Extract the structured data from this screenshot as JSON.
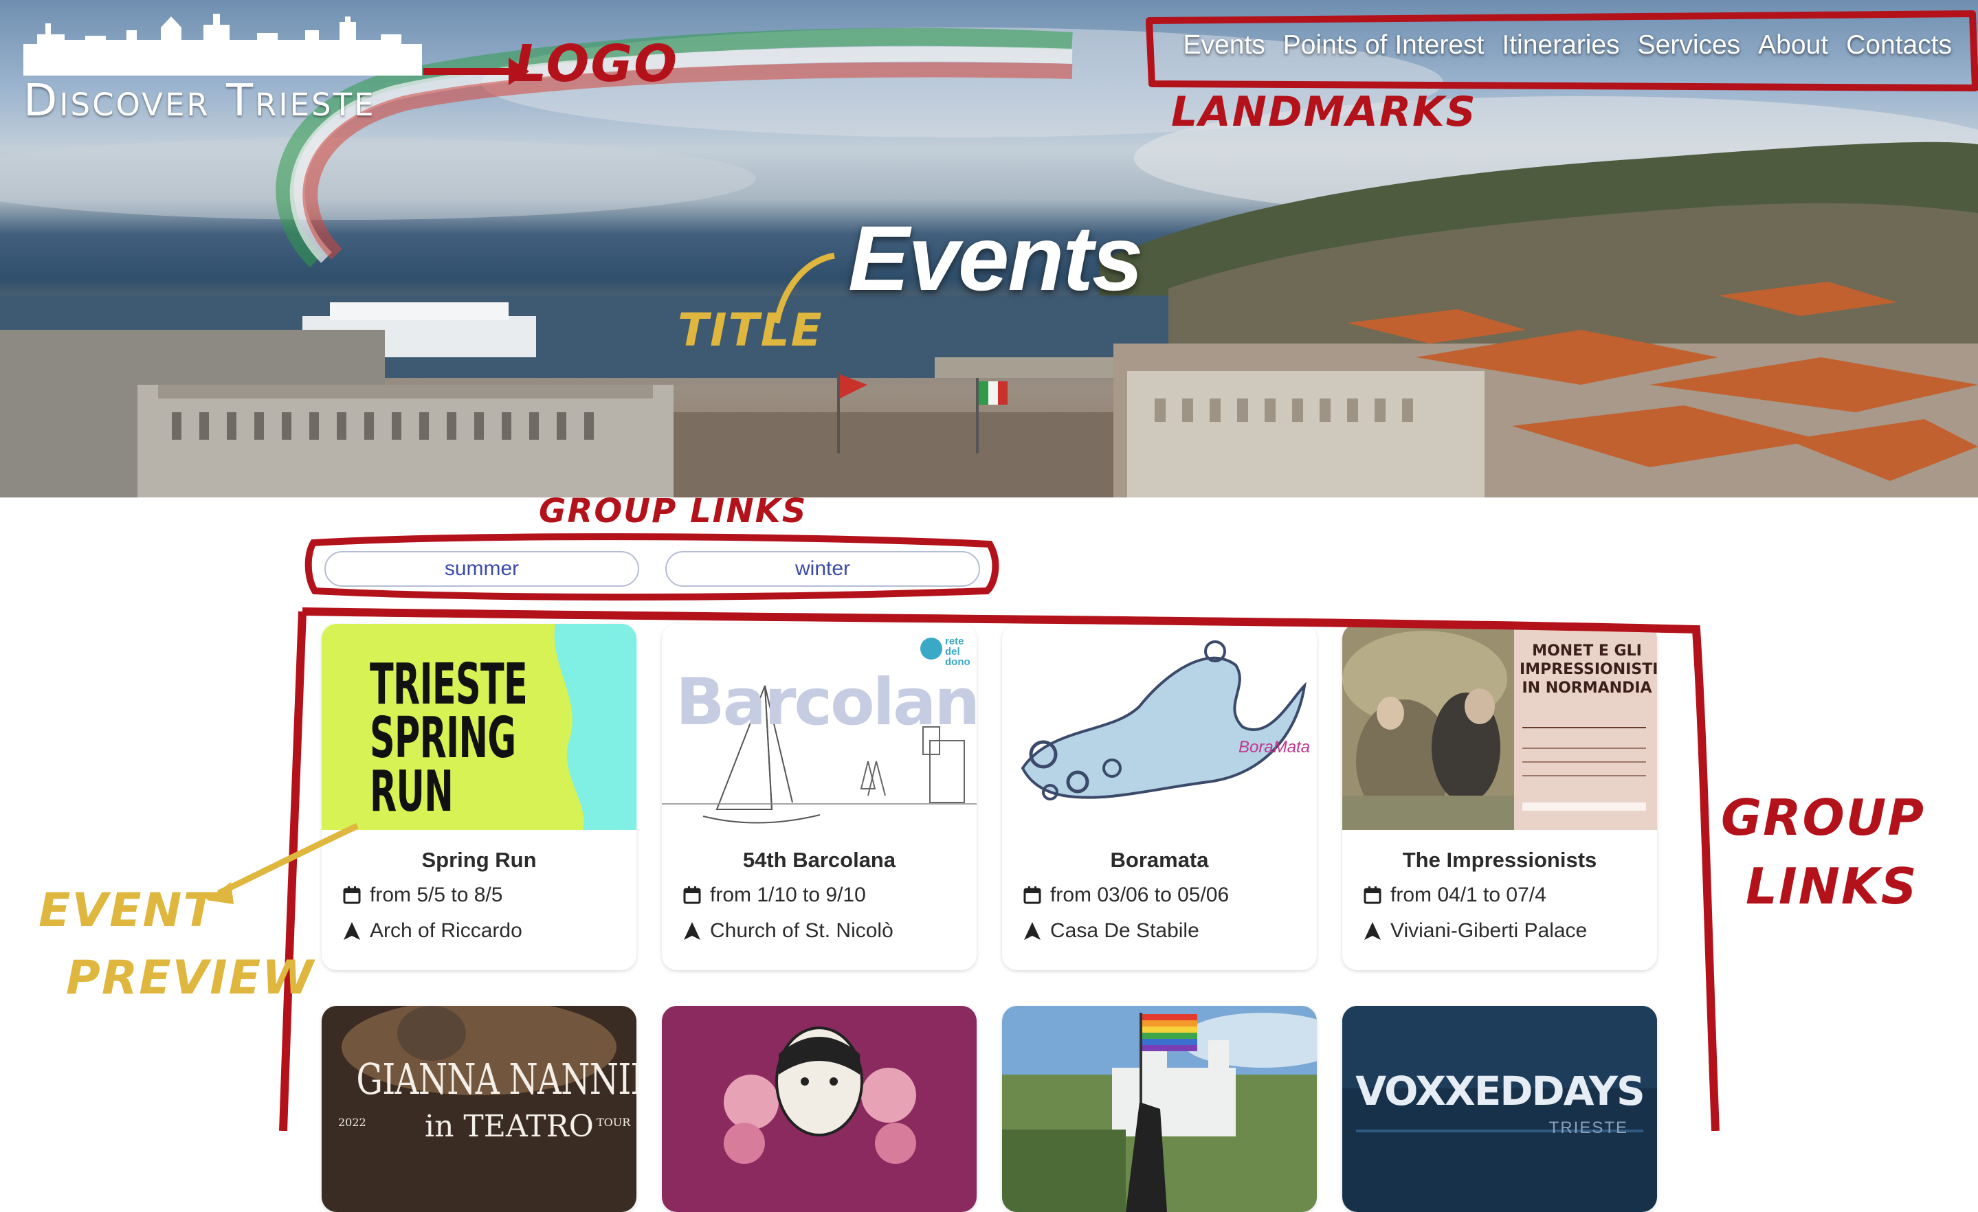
{
  "logo": {
    "text": "Discover Trieste"
  },
  "nav": {
    "items": [
      "Events",
      "Points of Interest",
      "Itineraries",
      "Services",
      "About",
      "Contacts"
    ]
  },
  "hero": {
    "title": "Events"
  },
  "groups": [
    "summer",
    "winter"
  ],
  "events": [
    {
      "title": "Spring Run",
      "date": "from 5/5 to 8/5",
      "place": "Arch of Riccardo",
      "image_text": [
        "TRIESTE",
        "SPRING",
        "RUN"
      ]
    },
    {
      "title": "54th Barcolana",
      "date": "from 1/10 to 9/10",
      "place": "Church of St. Nicolò",
      "image_text": [
        "Barcolana"
      ],
      "image_badge": "rete del dono"
    },
    {
      "title": "Boramata",
      "date": "from 03/06 to 05/06",
      "place": "Casa De Stabile",
      "image_text": [
        "BoraMata"
      ]
    },
    {
      "title": "The Impressionists",
      "date": "from 04/1 to 07/4",
      "place": "Viviani-Giberti Palace",
      "image_text": [
        "MONET E GLI",
        "IMPRESSIONISTI",
        "IN NORMANDIA"
      ]
    }
  ],
  "events_row2": [
    {
      "image_text": [
        "GIANNA NANNINI",
        "in TEATRO",
        "2022",
        "TOUR"
      ]
    },
    {
      "image_text": []
    },
    {
      "image_text": []
    },
    {
      "image_text": [
        "VOXXEDDAYS",
        "TRIESTE"
      ]
    }
  ],
  "annotations": {
    "logo": "LOGO",
    "landmarks": "LANDMARKS",
    "title": "TITLE",
    "group_links_top": "GROUP LINKS",
    "group_links_side": [
      "GROUP",
      "LINKS"
    ],
    "event_preview": [
      "EVENT",
      "PREVIEW"
    ]
  },
  "colors": {
    "annotation_red": "#b3121b",
    "annotation_gold": "#dfb63e",
    "link_blue": "#3a4aa8"
  }
}
